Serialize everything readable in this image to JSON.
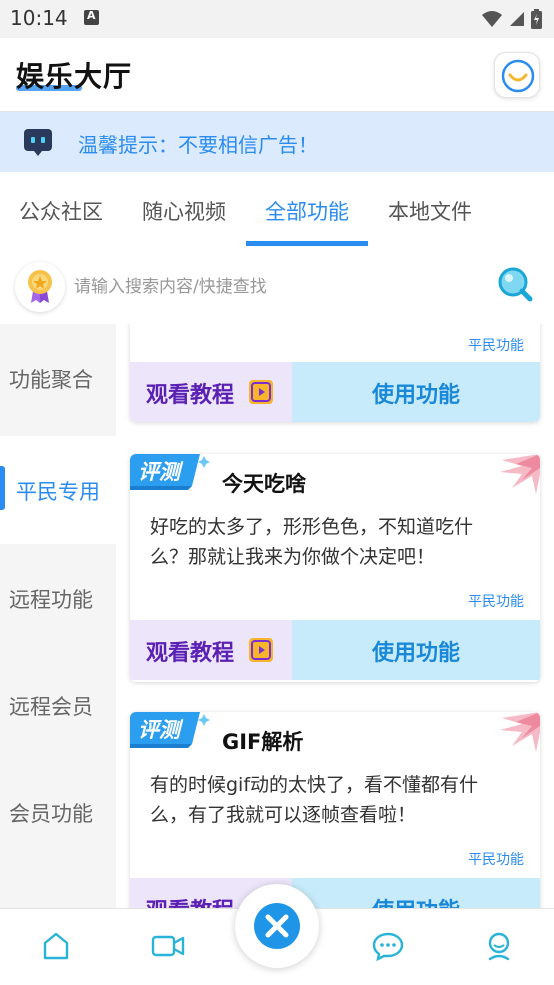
{
  "status_bar": {
    "time": "10:14"
  },
  "header": {
    "title": "娱乐大厅"
  },
  "notice": {
    "text": "温馨提示：不要相信广告！"
  },
  "tabs": [
    {
      "label": "公众社区"
    },
    {
      "label": "随心视频"
    },
    {
      "label": "全部功能",
      "active": true
    },
    {
      "label": "本地文件"
    }
  ],
  "search": {
    "placeholder": "请输入搜索内容/快捷查找"
  },
  "sidebar": {
    "items": [
      {
        "label": "功能聚合"
      },
      {
        "label": "平民专用",
        "active": true
      },
      {
        "label": "远程功能"
      },
      {
        "label": "远程会员"
      },
      {
        "label": "会员功能"
      }
    ]
  },
  "cards": [
    {
      "tag": "平民功能",
      "watch_label": "观看教程",
      "use_label": "使用功能"
    },
    {
      "badge": "评测",
      "title": "今天吃啥",
      "desc": "好吃的太多了，形形色色，不知道吃什么？那就让我来为你做个决定吧！",
      "tag": "平民功能",
      "watch_label": "观看教程",
      "use_label": "使用功能"
    },
    {
      "badge": "评测",
      "title": "GIF解析",
      "desc": "有的时候gif动的太快了，看不懂都有什么，有了我就可以逐帧查看啦！",
      "tag": "平民功能",
      "watch_label": "观看教程",
      "use_label": "使用功能"
    }
  ],
  "colors": {
    "accent": "#2b8cf0",
    "watch_bg": "#ede6fb",
    "use_bg": "#c7ebfb",
    "sidebar_bg": "#f5f5f5"
  },
  "icons": {
    "bottom_nav": [
      "home-icon",
      "video-icon",
      "close-icon",
      "chat-icon",
      "profile-icon"
    ]
  }
}
